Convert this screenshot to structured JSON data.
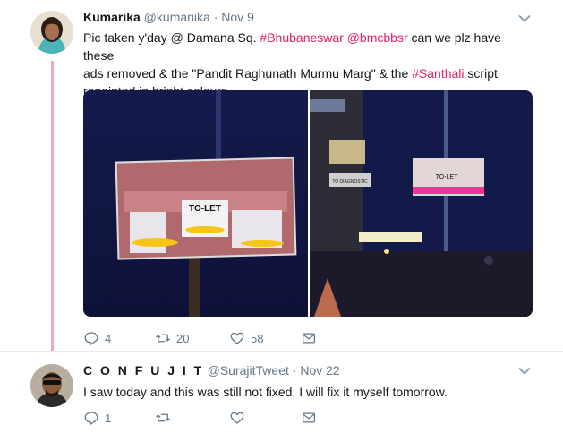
{
  "tweet1": {
    "author_name": "Kumarika",
    "handle": "@kumariika",
    "separator": "·",
    "date": "Nov 9",
    "text_line1_a": "Pic taken y'day @ Damana Sq. ",
    "hashtag1": "#Bhubaneswar",
    "mention1": "@bmcbbsr",
    "text_line1_b": " can we plz have these",
    "text_line2_a": "ads removed & the \"Pandit Raghunath Murmu Marg\" & the ",
    "hashtag2": "#Santhali",
    "text_line2_b": " script",
    "text_line3": "repainted in bright colours.",
    "photo1_sign_text": "TO-LET",
    "photo2_sign_text": "TO-LET",
    "photo2_street_sign": "TO DIAGNOSTIC",
    "replies": "4",
    "retweets": "20",
    "likes": "58"
  },
  "tweet2": {
    "author_name": "C O N F U J I T",
    "handle": "@SurajitTweet",
    "separator": "·",
    "date": "Nov 22",
    "text": "I saw today and this was still not fixed. I will fix it myself tomorrow.",
    "replies": "1"
  },
  "colors": {
    "hashtag": "#e0245e",
    "thread_line": "#f4a9b8",
    "muted": "#657786"
  }
}
